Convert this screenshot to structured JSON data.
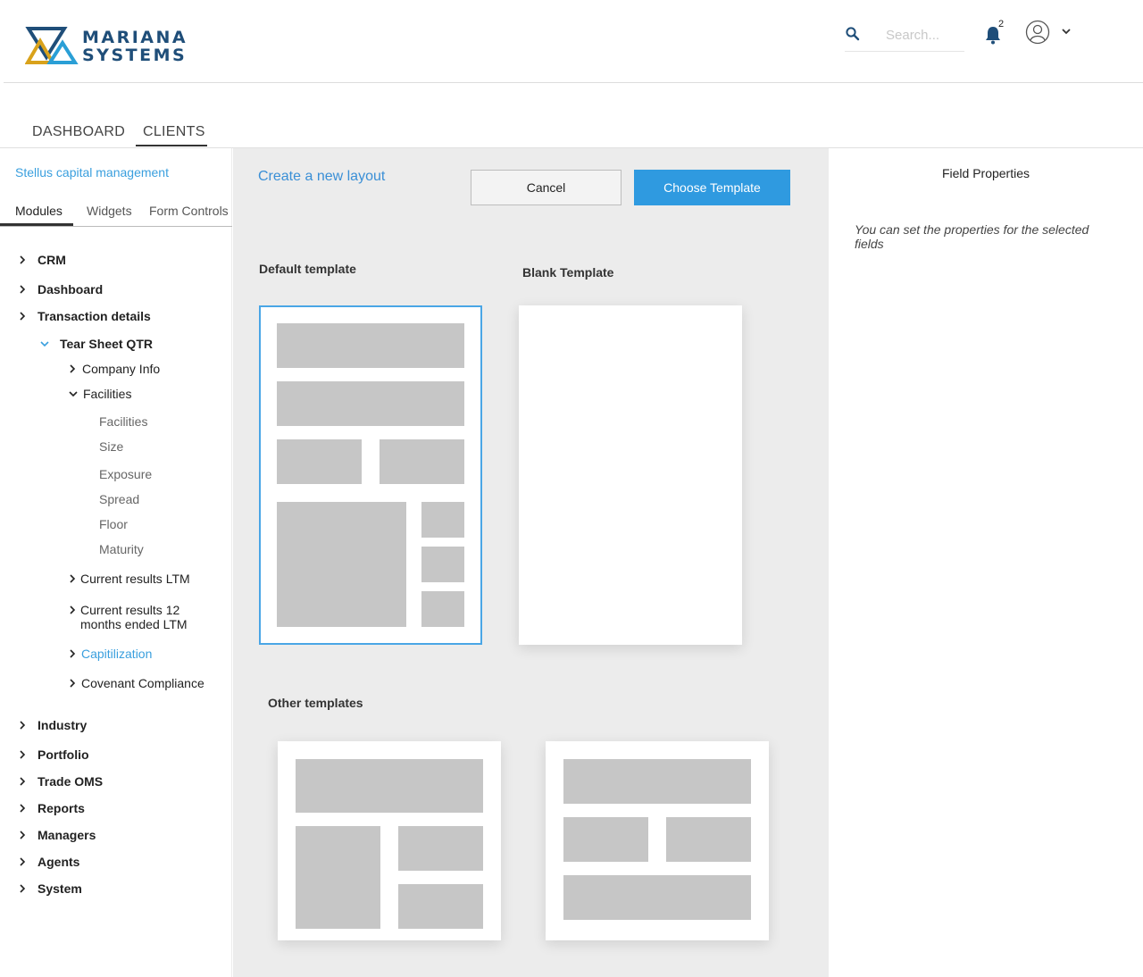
{
  "header": {
    "brand_line1": "MARIANA",
    "brand_line2": "SYSTEMS",
    "search_placeholder": "Search...",
    "notification_count": "2",
    "colors": {
      "brand_navy": "#1f4e79",
      "brand_gold": "#d9a21b",
      "brand_teal": "#2a9fd6"
    }
  },
  "nav": {
    "tabs": [
      {
        "label": "DASHBOARD",
        "active": false
      },
      {
        "label": "CLIENTS",
        "active": true
      }
    ]
  },
  "sidebar": {
    "client_name": "Stellus capital management",
    "tabs": [
      {
        "label": "Modules",
        "active": true
      },
      {
        "label": "Widgets",
        "active": false
      },
      {
        "label": "Form Controls",
        "active": false
      }
    ],
    "tree": {
      "crm": "CRM",
      "dashboard": "Dashboard",
      "transaction_details": "Transaction details",
      "tear_sheet": "Tear Sheet QTR",
      "company_info": "Company Info",
      "facilities": "Facilities",
      "facilities_children": [
        "Facilities",
        "Size",
        "Exposure",
        "Spread",
        "Floor",
        "Maturity"
      ],
      "current_results_ltm": "Current results LTM",
      "current_results_12_line1": "Current results 12",
      "current_results_12_line2": "months ended LTM",
      "capitalization": "Capitilization",
      "covenant": "Covenant Compliance",
      "industry": "Industry",
      "portfolio": "Portfolio",
      "trade_oms": "Trade OMS",
      "reports": "Reports",
      "managers": "Managers",
      "agents": "Agents",
      "system": "System"
    }
  },
  "canvas": {
    "create_link": "Create a new layout",
    "cancel_label": "Cancel",
    "choose_label": "Choose Template",
    "default_label": "Default template",
    "blank_label": "Blank Template",
    "other_label": "Other templates",
    "accent_color": "#2f9ae0"
  },
  "right_panel": {
    "title": "Field Properties",
    "hint": "You can set the properties for the selected fields"
  }
}
